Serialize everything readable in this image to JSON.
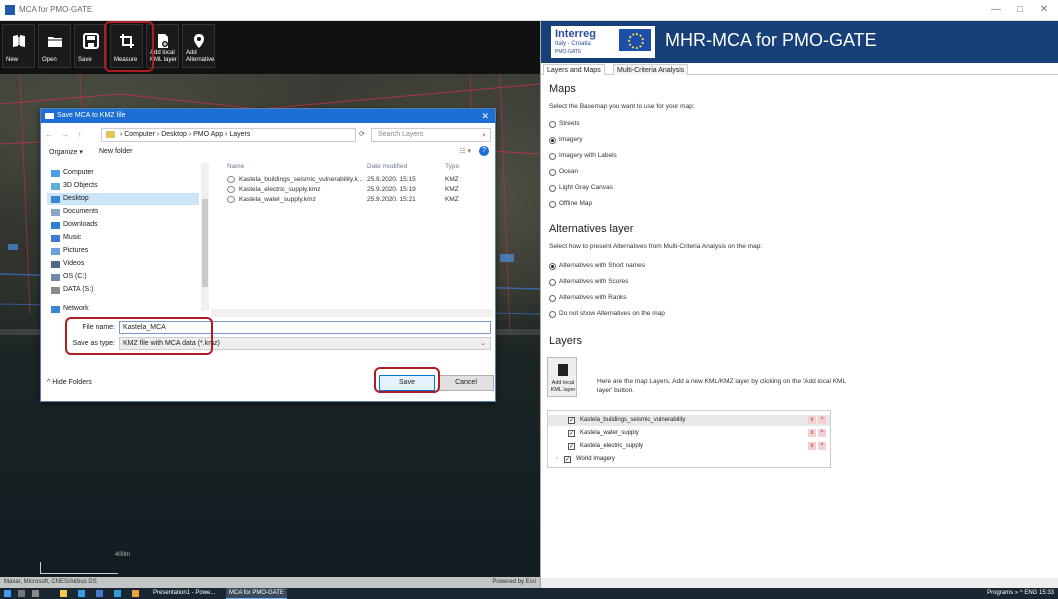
{
  "window": {
    "title": "MCA for PMO-GATE",
    "controls": [
      "—",
      "□",
      "✕"
    ]
  },
  "toolbar": {
    "new": "New",
    "open": "Open",
    "save": "Save",
    "measure": "Measure",
    "add_kml_line1": "Add local",
    "add_kml_line2": "KML layer",
    "add_alt_line1": "Add",
    "add_alt_line2": "Alternative"
  },
  "map": {
    "scale_top": "400m",
    "scale_bottom": "1000ft",
    "attribution": "Maxar, Microsoft, CNES/Airbus DS",
    "powered_by": "Powered by Esri"
  },
  "dialog": {
    "title": "Save MCA to KMZ file",
    "nav_arrows": "← → ↑",
    "path": [
      "Computer",
      "Desktop",
      "PMO App",
      "Layers"
    ],
    "search_placeholder": "Search Layers",
    "organize": "Organize ▾",
    "new_folder": "New folder",
    "nav_items": [
      {
        "label": "Computer",
        "icon": "computer-icon",
        "color": "#4aa0e6"
      },
      {
        "label": "3D Objects",
        "icon": "cube-icon",
        "color": "#5ab0d8"
      },
      {
        "label": "Desktop",
        "icon": "desktop-icon",
        "color": "#3a86d0"
      },
      {
        "label": "Documents",
        "icon": "document-icon",
        "color": "#8aa6c8"
      },
      {
        "label": "Downloads",
        "icon": "download-icon",
        "color": "#2d7dd2"
      },
      {
        "label": "Music",
        "icon": "music-icon",
        "color": "#3a7bd5"
      },
      {
        "label": "Pictures",
        "icon": "picture-icon",
        "color": "#6aa0d8"
      },
      {
        "label": "Videos",
        "icon": "video-icon",
        "color": "#506a84"
      },
      {
        "label": "OS (C:)",
        "icon": "drive-icon",
        "color": "#6e8aa8"
      },
      {
        "label": "DATA (S:)",
        "icon": "drive-icon",
        "color": "#8a8a8a"
      },
      {
        "label": "Network",
        "icon": "network-icon",
        "color": "#3a86d0"
      }
    ],
    "columns": {
      "name": "Name",
      "date": "Date modified",
      "type": "Type"
    },
    "files": [
      {
        "name": "Kastela_buildings_seismic_vulnerability.k...",
        "date": "25.9.2020. 15:15",
        "type": "KMZ"
      },
      {
        "name": "Kastela_electric_supply.kmz",
        "date": "25.9.2020. 15:19",
        "type": "KMZ"
      },
      {
        "name": "Kastela_water_supply.kmz",
        "date": "25.9.2020. 15:21",
        "type": "KMZ"
      }
    ],
    "file_name_label": "File name:",
    "file_name_value": "Kastela_MCA",
    "save_type_label": "Save as type:",
    "save_type_value": "KMZ file with MCA data (*.kmz)",
    "hide_folders": "Hide Folders",
    "save_button": "Save",
    "cancel_button": "Cancel"
  },
  "panel": {
    "app_title": "MHR-MCA for PMO-GATE",
    "logo_text": "Interreg",
    "logo_sub": "Italy - Croatia",
    "logo_sub2": "PMO-GATE",
    "tabs": [
      "Layers and Maps",
      "Multi-Criteria Analysis"
    ],
    "maps_heading": "Maps",
    "maps_desc": "Select the Basemap you want to use for your map:",
    "basemaps": [
      {
        "label": "Streets",
        "selected": false
      },
      {
        "label": "Imagery",
        "selected": true
      },
      {
        "label": "Imagery with Labels",
        "selected": false
      },
      {
        "label": "Ocean",
        "selected": false
      },
      {
        "label": "Light Gray Canvas",
        "selected": false
      },
      {
        "label": "Offline Map",
        "selected": false
      }
    ],
    "alt_heading": "Alternatives layer",
    "alt_desc": "Select how to present Alternatives from Multi-Criteria Analysis on the map:",
    "alt_options": [
      {
        "label": "Alternatives with Short names",
        "selected": true
      },
      {
        "label": "Alternatives with Scores",
        "selected": false
      },
      {
        "label": "Alternatives with Ranks",
        "selected": false
      },
      {
        "label": "Do not show Alternatives on the map",
        "selected": false
      }
    ],
    "layers_heading": "Layers",
    "add_kml_line1": "Add local",
    "add_kml_line2": "KML layer",
    "layers_desc": "Here are the map Layers. Add a new KML/KMZ layer by clicking on the 'Add local KML layer' button.",
    "layers": [
      {
        "name": "Kastela_buildings_seismic_vulnerability",
        "checked": true
      },
      {
        "name": "Kastela_water_supply",
        "checked": true
      },
      {
        "name": "Kastela_electric_supply",
        "checked": true
      },
      {
        "name": "World Imagery",
        "checked": true
      }
    ]
  },
  "taskbar": {
    "tasks": [
      "Presentation1 - Powe...",
      "MCA for PMO-GATE"
    ],
    "tray": "Programs »  ^  ENG  15:33"
  },
  "colors": {
    "accent": "#1d6fd6",
    "highlight": "#b01c24",
    "header": "#173f78"
  }
}
